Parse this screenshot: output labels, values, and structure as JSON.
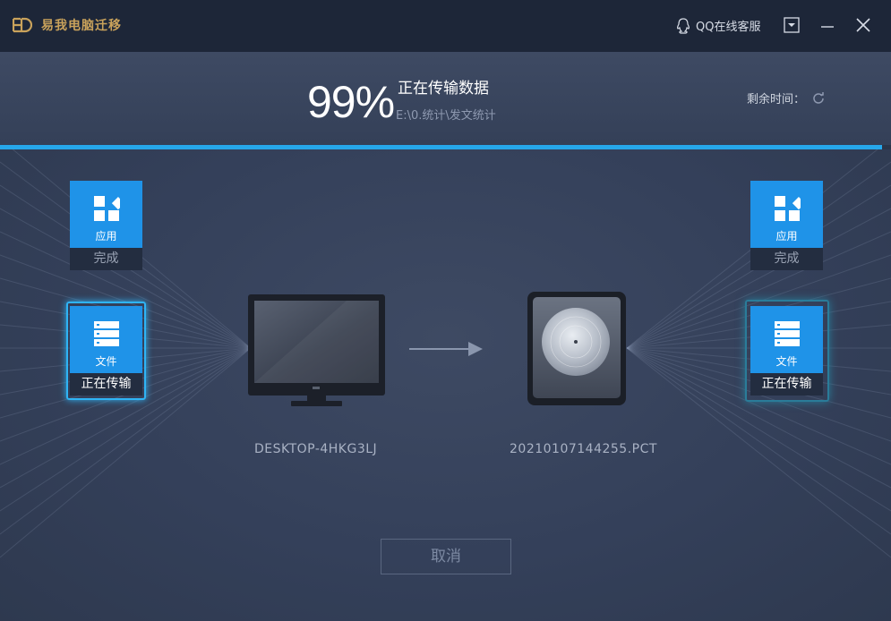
{
  "titlebar": {
    "app_title": "易我电脑迁移",
    "support_label": "QQ在线客服",
    "icons": [
      "logo-icon",
      "qq-icon",
      "dropdown-icon",
      "minimize-icon",
      "close-icon"
    ]
  },
  "header": {
    "percent": "99%",
    "status_title": "正在传输数据",
    "current_path": "E:\\0.统计\\发文统计",
    "remaining_label": "剩余时间："
  },
  "progress": {
    "value": 0.99,
    "color": "#26a7ea"
  },
  "source": {
    "device_name": "DESKTOP-4HKG3LJ",
    "tiles": [
      {
        "label": "应用",
        "status": "完成"
      },
      {
        "label": "文件",
        "status": "正在传输"
      }
    ]
  },
  "target": {
    "device_name": "20210107144255.PCT",
    "tiles": [
      {
        "label": "应用",
        "status": "完成"
      },
      {
        "label": "文件",
        "status": "正在传输"
      }
    ]
  },
  "actions": {
    "cancel_label": "取消"
  },
  "colors": {
    "accent": "#1f93e8",
    "brand": "#c9a25b",
    "background": "#33405a"
  }
}
